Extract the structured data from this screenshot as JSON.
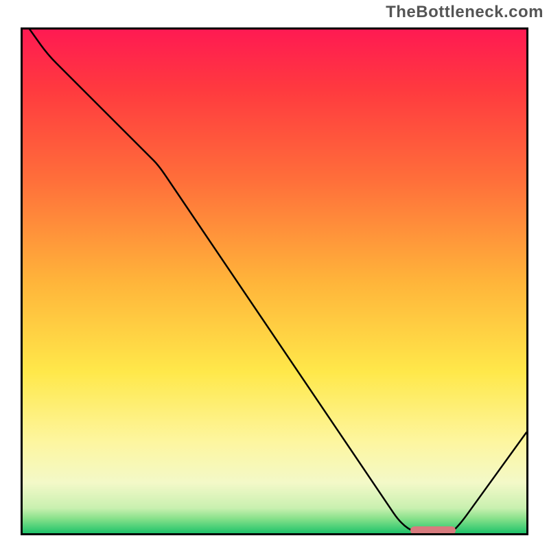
{
  "watermark": "TheBottleneck.com",
  "chart_data": {
    "type": "line",
    "title": "",
    "xlabel": "",
    "ylabel": "",
    "xlim": [
      0,
      100
    ],
    "ylim": [
      0,
      100
    ],
    "x": [
      0,
      5,
      25,
      27,
      75,
      78,
      85,
      87,
      100
    ],
    "values": [
      102,
      95,
      75,
      73,
      2,
      0,
      0,
      2,
      20
    ],
    "marker": {
      "x_start": 77,
      "x_end": 86,
      "y": 0.5
    },
    "gradient_stops": [
      {
        "pct": 0,
        "color": "#ff1a52"
      },
      {
        "pct": 12,
        "color": "#ff3a3f"
      },
      {
        "pct": 30,
        "color": "#ff6f3a"
      },
      {
        "pct": 50,
        "color": "#ffb43a"
      },
      {
        "pct": 68,
        "color": "#ffe84a"
      },
      {
        "pct": 82,
        "color": "#fdf6a0"
      },
      {
        "pct": 90,
        "color": "#f3f9c8"
      },
      {
        "pct": 95,
        "color": "#c9f0b0"
      },
      {
        "pct": 97,
        "color": "#8be28c"
      },
      {
        "pct": 100,
        "color": "#1fc36a"
      }
    ]
  }
}
